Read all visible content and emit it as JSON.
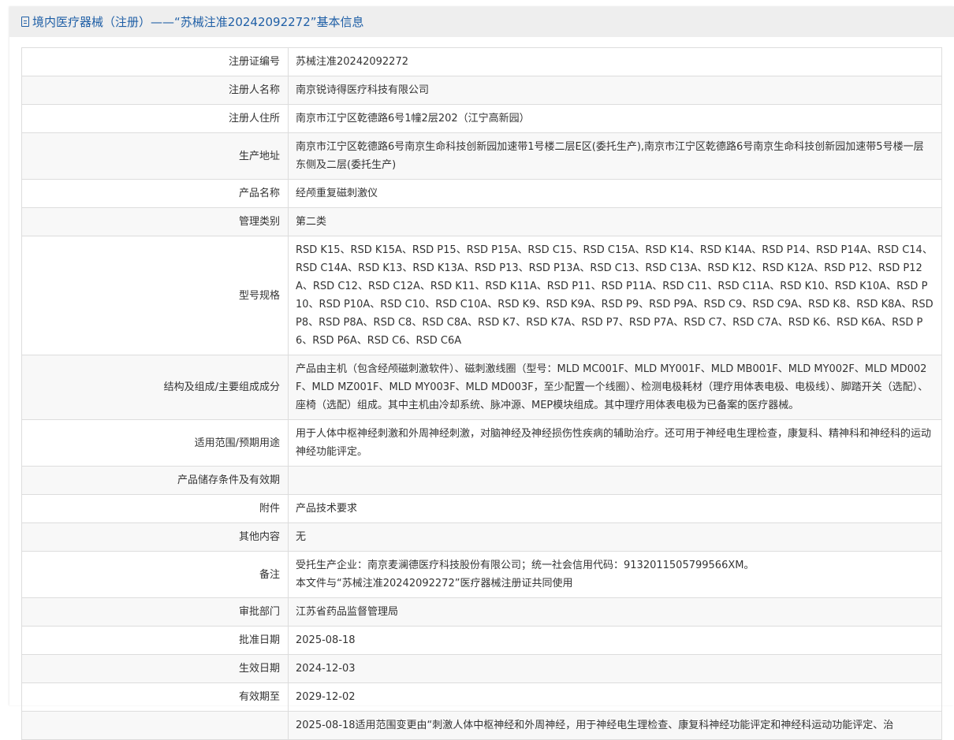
{
  "header": {
    "title": "境内医疗器械（注册）——“苏械注准20242092272”基本信息"
  },
  "rows": [
    {
      "label": "注册证编号",
      "value": "苏械注准20242092272"
    },
    {
      "label": "注册人名称",
      "value": "南京锐诗得医疗科技有限公司"
    },
    {
      "label": "注册人住所",
      "value": "南京市江宁区乾德路6号1幢2层202（江宁高新园）"
    },
    {
      "label": "生产地址",
      "value": "南京市江宁区乾德路6号南京生命科技创新园加速带1号楼二层E区(委托生产),南京市江宁区乾德路6号南京生命科技创新园加速带5号楼一层东侧及二层(委托生产)"
    },
    {
      "label": "产品名称",
      "value": "经颅重复磁刺激仪"
    },
    {
      "label": "管理类别",
      "value": "第二类"
    },
    {
      "label": "型号规格",
      "value": "RSD K15、RSD K15A、RSD P15、RSD P15A、RSD C15、RSD C15A、RSD K14、RSD K14A、RSD P14、RSD P14A、RSD C14、RSD C14A、RSD K13、RSD K13A、RSD P13、RSD P13A、RSD C13、RSD C13A、RSD K12、RSD K12A、RSD P12、RSD P12A、RSD C12、RSD C12A、RSD K11、RSD K11A、RSD P11、RSD P11A、RSD C11、RSD C11A、RSD K10、RSD K10A、RSD P10、RSD P10A、RSD C10、RSD C10A、RSD K9、RSD K9A、RSD P9、RSD P9A、RSD C9、RSD C9A、RSD K8、RSD K8A、RSD P8、RSD P8A、RSD C8、RSD C8A、RSD K7、RSD K7A、RSD P7、RSD P7A、RSD C7、RSD C7A、RSD K6、RSD K6A、RSD P6、RSD P6A、RSD C6、RSD C6A"
    },
    {
      "label": "结构及组成/主要组成成分",
      "value": "产品由主机（包含经颅磁刺激软件）、磁刺激线圈（型号：MLD MC001F、MLD MY001F、MLD MB001F、MLD MY002F、MLD MD002F、MLD MZ001F、MLD MY003F、MLD MD003F，至少配置一个线圈）、检测电极耗材（理疗用体表电极、电极线）、脚踏开关（选配）、座椅（选配）组成。其中主机由冷却系统、脉冲源、MEP模块组成。其中理疗用体表电极为已备案的医疗器械。"
    },
    {
      "label": "适用范围/预期用途",
      "value": "用于人体中枢神经刺激和外周神经刺激，对脑神经及神经损伤性疾病的辅助治疗。还可用于神经电生理检查，康复科、精神科和神经科的运动神经功能评定。"
    },
    {
      "label": "产品储存条件及有效期",
      "value": ""
    },
    {
      "label": "附件",
      "value": "产品技术要求"
    },
    {
      "label": "其他内容",
      "value": "无"
    },
    {
      "label": "备注",
      "value": "受托生产企业：南京麦澜德医疗科技股份有限公司；统一社会信用代码：913201150579956­6XM。",
      "value2": "本文件与“苏械注准20242092272”医疗器械注册证共同使用"
    },
    {
      "label": "审批部门",
      "value": "江苏省药品监督管理局"
    },
    {
      "label": "批准日期",
      "value": "2025-08-18"
    },
    {
      "label": "生效日期",
      "value": "2024-12-03"
    },
    {
      "label": "有效期至",
      "value": "2029-12-02"
    },
    {
      "label": "",
      "value": "2025-08-18适用范围变更由“刺激人体中枢神经和外周神经，用于神经电生理检查、康复科神经功能评定和神经科运动功能评定、治"
    }
  ]
}
